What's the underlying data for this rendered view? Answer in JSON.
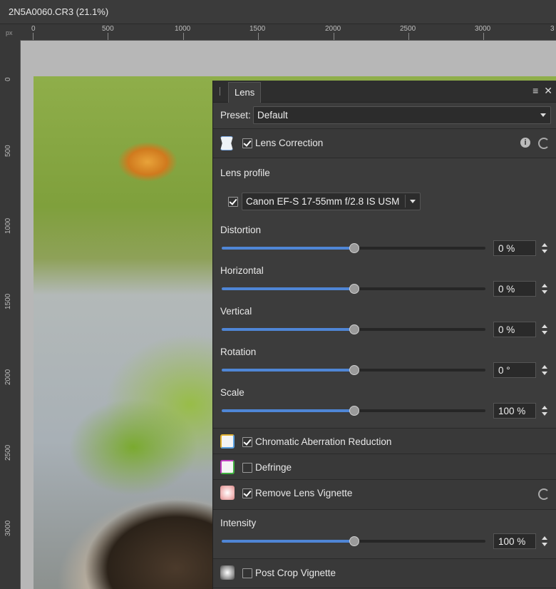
{
  "window": {
    "title": "2N5A0060.CR3 (21.1%)"
  },
  "ruler": {
    "unit": "px",
    "top_labels": [
      "0",
      "500",
      "1000",
      "1500",
      "2000",
      "2500",
      "3000",
      "3"
    ],
    "left_labels": [
      "0",
      "500",
      "1000",
      "1500",
      "2000",
      "2500",
      "3000"
    ]
  },
  "panel": {
    "tab": "Lens",
    "menu_icon": "menu-icon",
    "close_icon": "close-icon",
    "preset_label": "Preset:",
    "preset_value": "Default",
    "lens_correction": {
      "label": "Lens Correction",
      "checked": true,
      "lens_profile_label": "Lens profile",
      "lens_profile_checked": true,
      "lens_profile_value": "Canon EF-S 17-55mm f/2.8 IS USM",
      "sliders": [
        {
          "label": "Distortion",
          "value": "0 %",
          "position": 0.5
        },
        {
          "label": "Horizontal",
          "value": "0 %",
          "position": 0.5
        },
        {
          "label": "Vertical",
          "value": "0 %",
          "position": 0.5
        },
        {
          "label": "Rotation",
          "value": "0 °",
          "position": 0.5
        },
        {
          "label": "Scale",
          "value": "100 %",
          "position": 0.5
        }
      ]
    },
    "chromatic": {
      "label": "Chromatic Aberration Reduction",
      "checked": true
    },
    "defringe": {
      "label": "Defringe",
      "checked": false
    },
    "vignette": {
      "label": "Remove Lens Vignette",
      "checked": true,
      "intensity_label": "Intensity",
      "intensity_value": "100 %",
      "intensity_position": 0.5
    },
    "post_crop": {
      "label": "Post Crop Vignette",
      "checked": false
    }
  },
  "colors": {
    "accent": "#4f86d6",
    "panel_bg": "#3c3c3c"
  }
}
